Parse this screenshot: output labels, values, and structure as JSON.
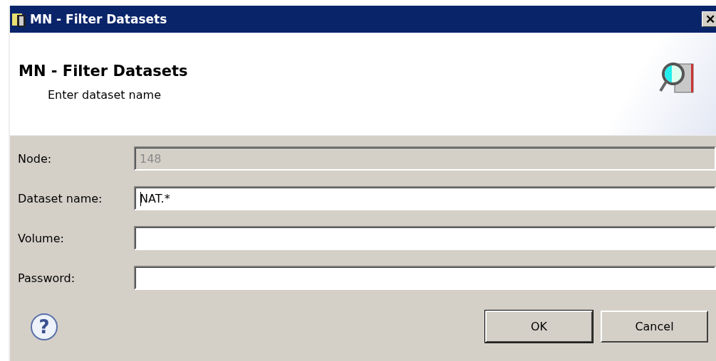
{
  "window": {
    "title": "MN - Filter Datasets",
    "close": "✕"
  },
  "help": "?",
  "header": {
    "title": "MN - Filter Datasets",
    "subtitle": "Enter dataset name"
  },
  "fields": [
    {
      "label": "Node:",
      "value": "148",
      "disabled": true,
      "focused": false
    },
    {
      "label": "Dataset name:",
      "value": "NAT.*",
      "disabled": false,
      "focused": true
    },
    {
      "label": "Volume:",
      "disabled": false,
      "focused": false
    },
    {
      "label": "Password:",
      "disabled": false,
      "focused": false
    }
  ],
  "buttons": [
    {
      "label": "OK",
      "default": true
    },
    {
      "label": "Cancel",
      "default": false
    }
  ]
}
